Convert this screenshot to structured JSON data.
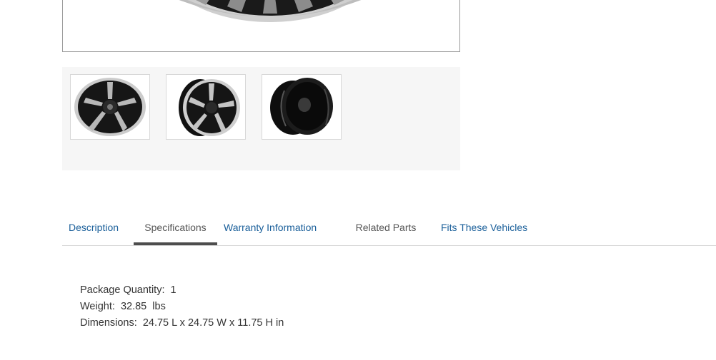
{
  "gallery": {
    "main_image_icon": "wheel-image",
    "thumbnails": [
      {
        "icon": "wheel-front-view-icon"
      },
      {
        "icon": "wheel-angled-view-icon"
      },
      {
        "icon": "wheel-side-view-icon"
      }
    ]
  },
  "tabs": [
    {
      "label": "Description",
      "state": "link"
    },
    {
      "label": "Specifications",
      "state": "active"
    },
    {
      "label": "Warranty Information",
      "state": "link"
    },
    {
      "label": "Related Parts",
      "state": "muted"
    },
    {
      "label": "Fits These Vehicles",
      "state": "link"
    }
  ],
  "specifications": {
    "package_quantity": {
      "label": "Package Quantity:",
      "value": "1"
    },
    "weight": {
      "label": "Weight:",
      "value": "32.85  lbs"
    },
    "dimensions": {
      "label": "Dimensions:",
      "value": "24.75 L x 24.75 W x 11.75 H in"
    }
  },
  "colors": {
    "link": "#1a5f9a",
    "active_tab_underline": "#4d4d4d",
    "thumb_strip_bg": "#f6f6f6"
  }
}
